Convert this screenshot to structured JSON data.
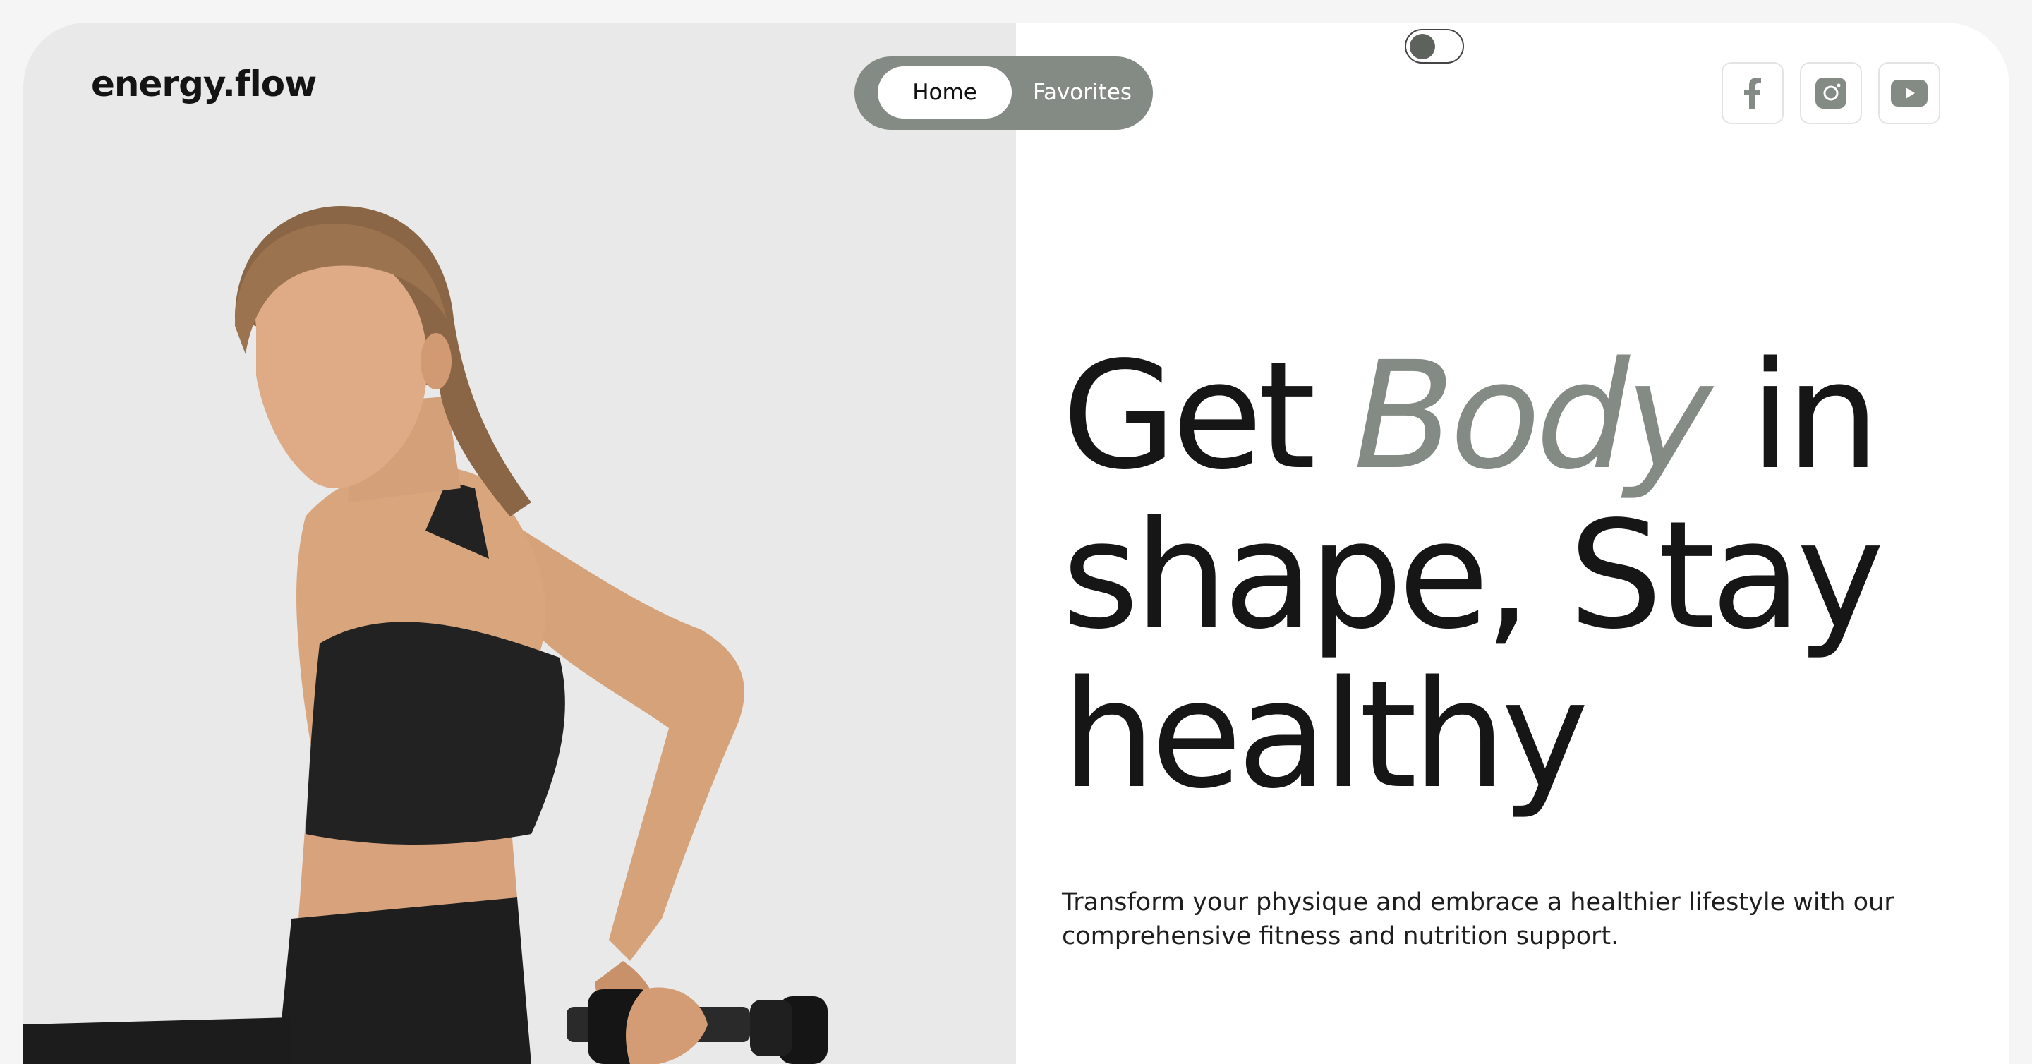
{
  "brand": {
    "logo": "energy.flow"
  },
  "nav": {
    "home": "Home",
    "favorites": "Favorites"
  },
  "theme_toggle": {
    "state": "off"
  },
  "social": [
    "facebook-icon",
    "instagram-icon",
    "youtube-icon"
  ],
  "hero": {
    "title_part1": "Get ",
    "title_accent": "Body",
    "title_part2": " in shape, Stay healthy",
    "subtitle": "Transform your physique and embrace a healthier lifestyle with our comprehensive fitness and nutrition support."
  },
  "colors": {
    "accent": "#848a84",
    "text": "#161616",
    "left_bg": "#e9e9ea",
    "page_bg": "#f5f5f5"
  }
}
